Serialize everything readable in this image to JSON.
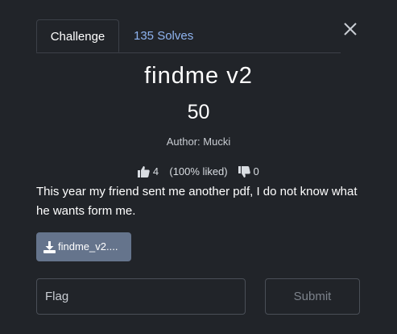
{
  "tabs": [
    {
      "label": "Challenge",
      "active": true
    },
    {
      "label": "135 Solves",
      "active": false
    }
  ],
  "challenge": {
    "name": "findme v2",
    "value": "50",
    "author": "Author: Mucki",
    "likes": "4",
    "liked_percent": "(100% liked)",
    "dislikes": "0",
    "description": "This year my friend sent me another pdf, I do not know what he wants form me.",
    "file_label": "findme_v2...."
  },
  "form": {
    "flag_placeholder": "Flag",
    "flag_value": "",
    "submit_label": "Submit"
  },
  "icons": {
    "close": "close-icon",
    "like": "thumbs-up-icon",
    "dislike": "thumbs-down-icon",
    "download": "download-icon"
  },
  "colors": {
    "background": "#212429",
    "tab_link": "#8fb4f0",
    "file_button": "#65748c"
  }
}
